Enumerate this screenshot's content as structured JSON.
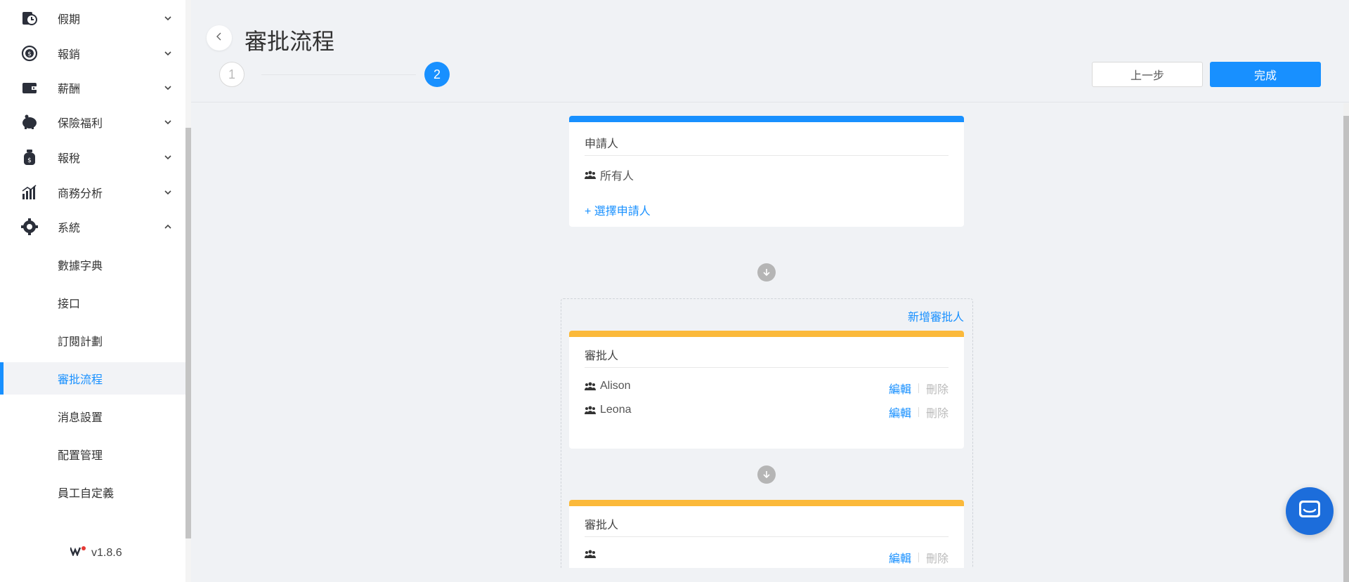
{
  "sidebar": {
    "menu": [
      {
        "label": "假期",
        "icon": "calendar-clock-icon"
      },
      {
        "label": "報銷",
        "icon": "money-refresh-icon"
      },
      {
        "label": "薪酬",
        "icon": "wallet-icon"
      },
      {
        "label": "保險福利",
        "icon": "piggy-bank-icon"
      },
      {
        "label": "報稅",
        "icon": "money-bag-icon"
      },
      {
        "label": "商務分析",
        "icon": "bar-chart-icon"
      },
      {
        "label": "系統",
        "icon": "gear-icon"
      }
    ],
    "submenu": [
      {
        "label": "數據字典"
      },
      {
        "label": "接口"
      },
      {
        "label": "訂閱計劃"
      },
      {
        "label": "審批流程",
        "active": true
      },
      {
        "label": "消息設置"
      },
      {
        "label": "配置管理"
      },
      {
        "label": "員工自定義"
      }
    ],
    "version": "v1.8.6"
  },
  "header": {
    "title": "審批流程",
    "steps": [
      "1",
      "2"
    ],
    "current_step": 2,
    "prev_label": "上一步",
    "done_label": "完成"
  },
  "applicant_card": {
    "title": "申請人",
    "members": [
      "所有人"
    ],
    "select_link": "+ 選擇申請人"
  },
  "approver_section": {
    "add_label": "新增審批人",
    "cards": [
      {
        "title": "審批人",
        "rows": [
          {
            "name": "Alison",
            "edit": "編輯",
            "delete": "刪除"
          },
          {
            "name": "Leona",
            "edit": "編輯",
            "delete": "刪除"
          }
        ]
      },
      {
        "title": "審批人",
        "rows": [
          {
            "name": "",
            "edit": "編輯",
            "delete": "刪除"
          }
        ]
      }
    ]
  },
  "colors": {
    "accent": "#1890ff",
    "approver_bar": "#fbb93a",
    "chat": "#1c6ddb"
  }
}
